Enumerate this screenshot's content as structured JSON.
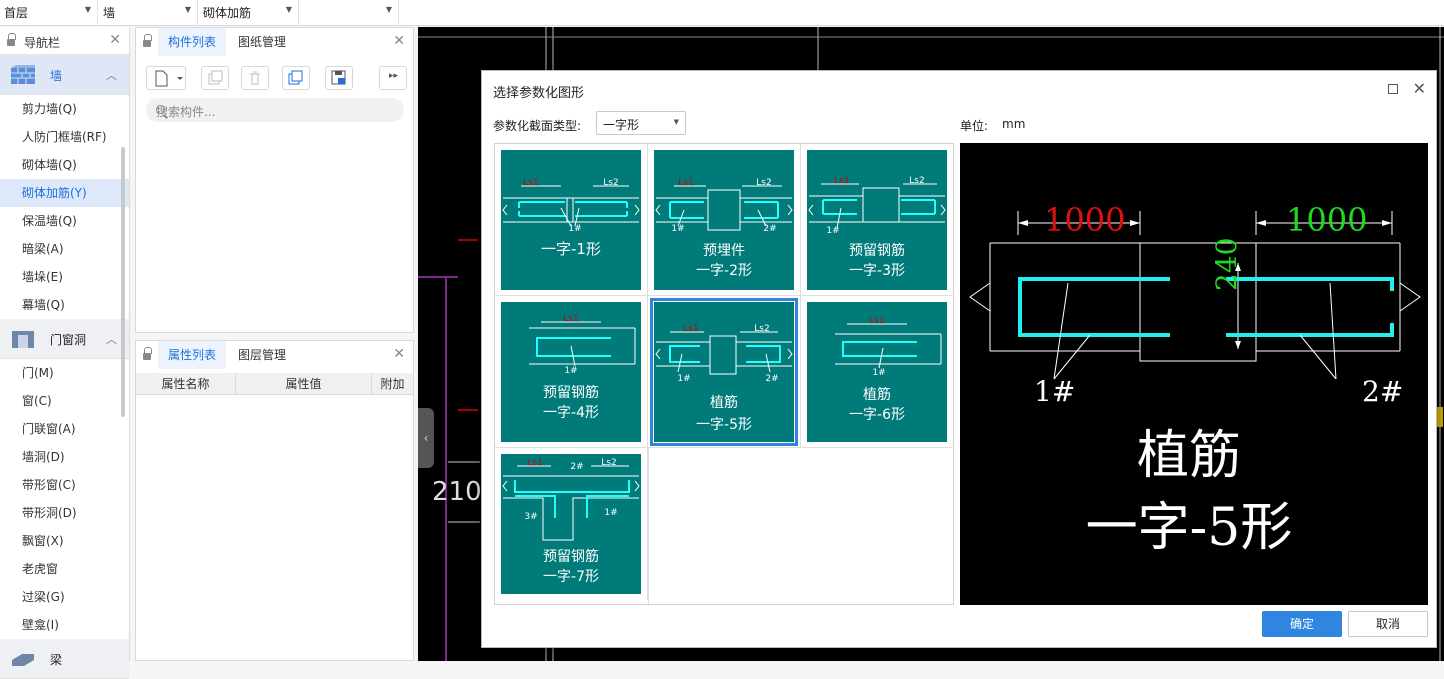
{
  "topbar": {
    "floor": "首层",
    "type": "墙",
    "subtype": "砌体加筋",
    "extra": ""
  },
  "nav": {
    "title": "导航栏",
    "cat_wall": "墙",
    "items_wall": [
      "剪力墙(Q)",
      "人防门框墙(RF)",
      "砌体墙(Q)",
      "砌体加筋(Y)",
      "保温墙(Q)",
      "暗梁(A)",
      "墙垛(E)",
      "幕墙(Q)"
    ],
    "cat_door": "门窗洞",
    "items_door": [
      "门(M)",
      "窗(C)",
      "门联窗(A)",
      "墙洞(D)",
      "带形窗(C)",
      "带形洞(D)",
      "飘窗(X)",
      "老虎窗",
      "过梁(G)",
      "壁龛(I)"
    ],
    "cat_next": "梁"
  },
  "complist": {
    "tab1": "构件列表",
    "tab2": "图纸管理",
    "search_placeholder": "搜索构件..."
  },
  "proplist": {
    "tab1": "属性列表",
    "tab2": "图层管理",
    "col1": "属性名称",
    "col2": "属性值",
    "col3": "附加"
  },
  "canvas": {
    "dim": "210"
  },
  "dialog": {
    "title": "选择参数化图形",
    "type_label": "参数化截面类型:",
    "type_value": "一字形",
    "unit_label": "单位:",
    "unit_value": "mm",
    "ok": "确定",
    "cancel": "取消",
    "shapes": [
      {
        "l1": "一字-1形",
        "l2": ""
      },
      {
        "l1": "预埋件",
        "l2": "一字-2形"
      },
      {
        "l1": "预留钢筋",
        "l2": "一字-3形"
      },
      {
        "l1": "预留钢筋",
        "l2": "一字-4形"
      },
      {
        "l1": "植筋",
        "l2": "一字-5形"
      },
      {
        "l1": "植筋",
        "l2": "一字-6形"
      },
      {
        "l1": "预留钢筋",
        "l2": "一字-7形"
      }
    ],
    "thumb_labels": {
      "ls1": "Ls1",
      "ls2": "Ls2",
      "b1": "b1",
      "r1": "1#",
      "r2": "2#",
      "r3": "3#"
    },
    "preview": {
      "dim_left": "1000",
      "dim_right": "1000",
      "dim_thick": "240",
      "r1": "1#",
      "r2": "2#",
      "name": "植筋",
      "shape": "一字-5形"
    }
  }
}
